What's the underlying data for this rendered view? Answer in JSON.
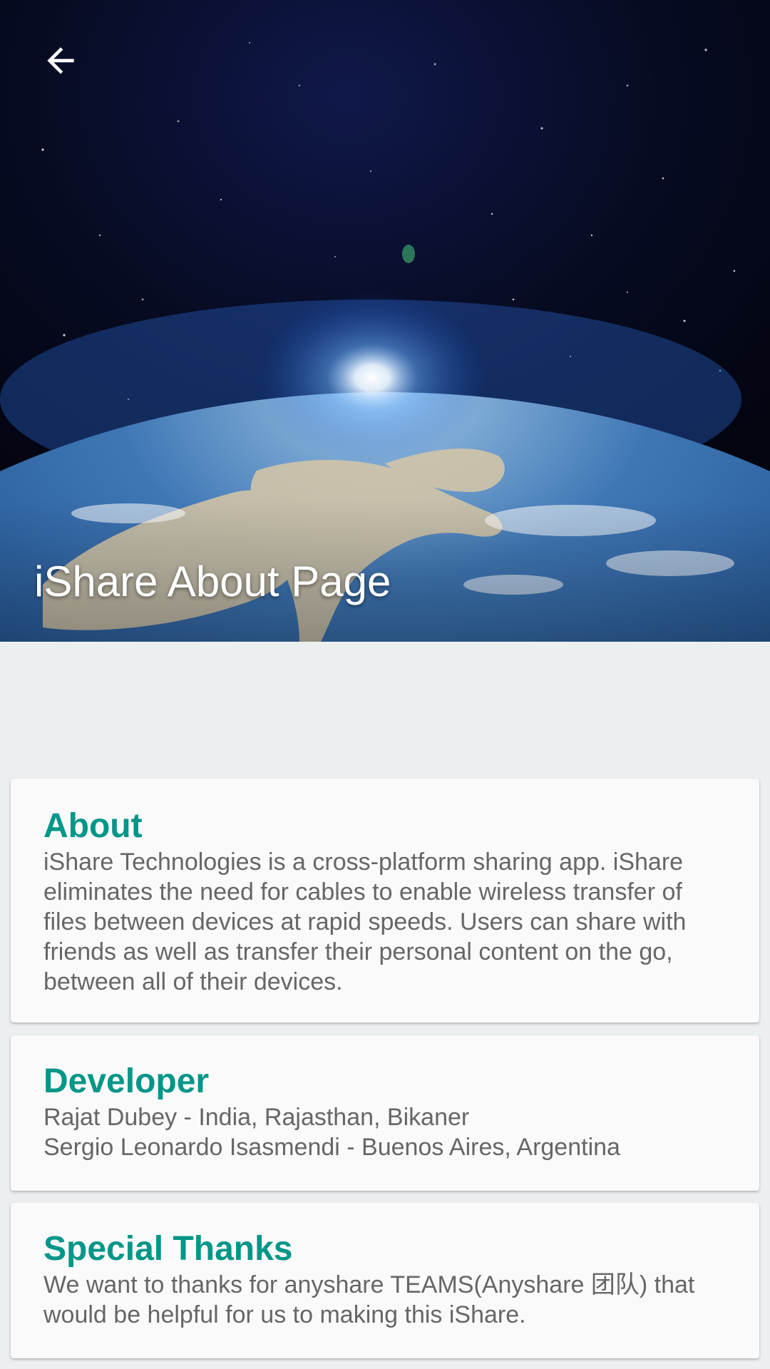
{
  "header": {
    "title": "iShare About Page",
    "back_icon": "arrow-back-icon"
  },
  "colors": {
    "accent": "#009688",
    "body_text": "#666666",
    "card_background": "#FAFAFA",
    "page_background": "#ECEFF0"
  },
  "cards": {
    "about": {
      "title": "About",
      "body": "iShare Technologies is a cross-platform sharing app. iShare eliminates the need for cables to enable wireless transfer of files between devices at rapid speeds. Users can share with friends as well as transfer their personal content on the go, between all of their devices."
    },
    "developer": {
      "title": "Developer",
      "lines": [
        "Rajat Dubey - India, Rajasthan, Bikaner",
        "Sergio Leonardo Isasmendi - Buenos Aires, Argentina"
      ]
    },
    "thanks": {
      "title": "Special Thanks",
      "body": "We want to thanks for anyshare TEAMS(Anyshare 团队) that would be helpful for us to making this iShare."
    }
  }
}
